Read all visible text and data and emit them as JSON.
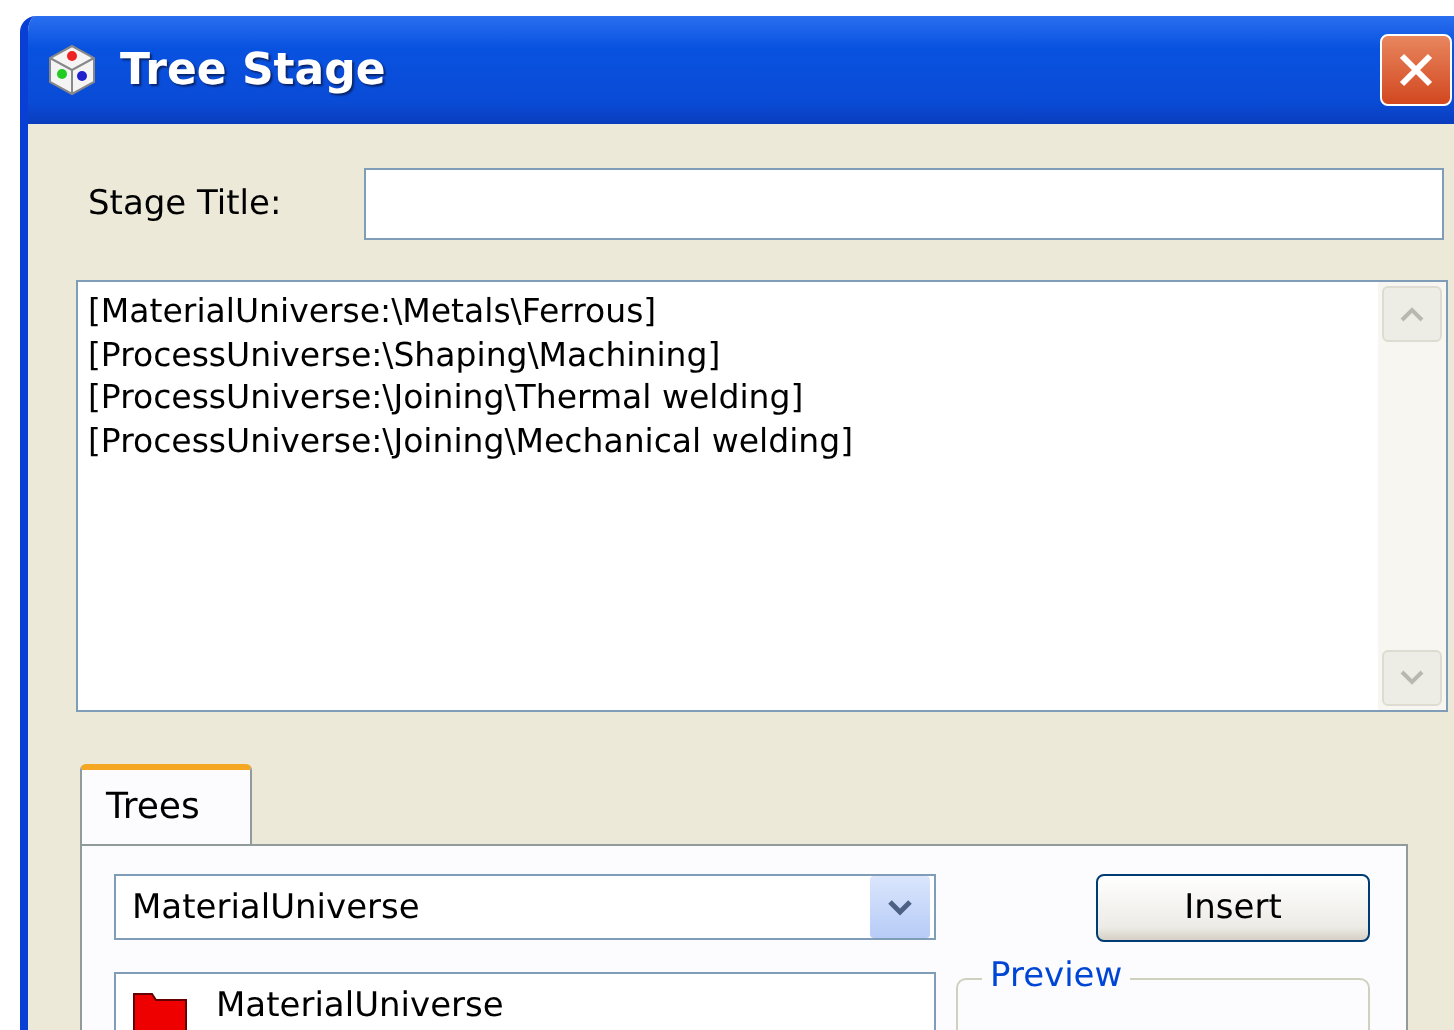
{
  "window": {
    "title": "Tree Stage"
  },
  "stage_title": {
    "label": "Stage Title:"
  },
  "stage_lines": [
    "[MaterialUniverse:\\Metals\\Ferrous]",
    "[ProcessUniverse:\\Shaping\\Machining]",
    "[ProcessUniverse:\\Joining\\Thermal welding]",
    "[ProcessUniverse:\\Joining\\Mechanical welding]"
  ],
  "tabs": [
    {
      "label": "Trees",
      "selected": true
    }
  ],
  "tree_select": {
    "value": "MaterialUniverse"
  },
  "insert_button": "Insert",
  "tree": [
    {
      "label": "MaterialUniverse"
    }
  ],
  "preview": {
    "title": "Preview"
  }
}
